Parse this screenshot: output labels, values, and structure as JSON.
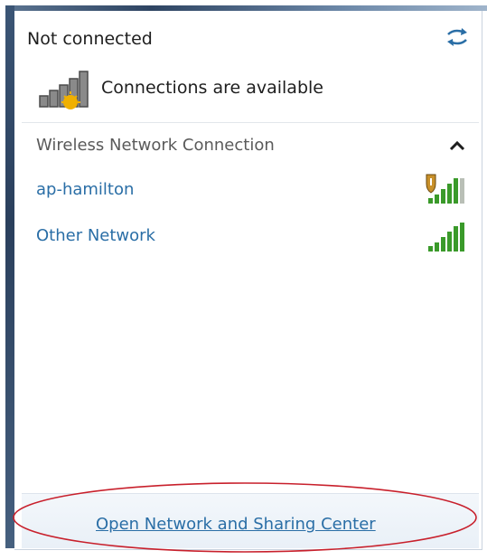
{
  "status": {
    "title": "Not connected",
    "subtitle": "Connections are available"
  },
  "section": {
    "title": "Wireless Network Connection"
  },
  "networks": [
    {
      "name": "ap-hamilton",
      "signal_icon": "signal-secured-icon"
    },
    {
      "name": "Other Network",
      "signal_icon": "signal-open-icon"
    }
  ],
  "footer": {
    "link_label": "Open Network and Sharing Center"
  },
  "colors": {
    "link": "#2a6ea6",
    "signal_green": "#3a9a2a",
    "annotation_red": "#c8202c"
  }
}
